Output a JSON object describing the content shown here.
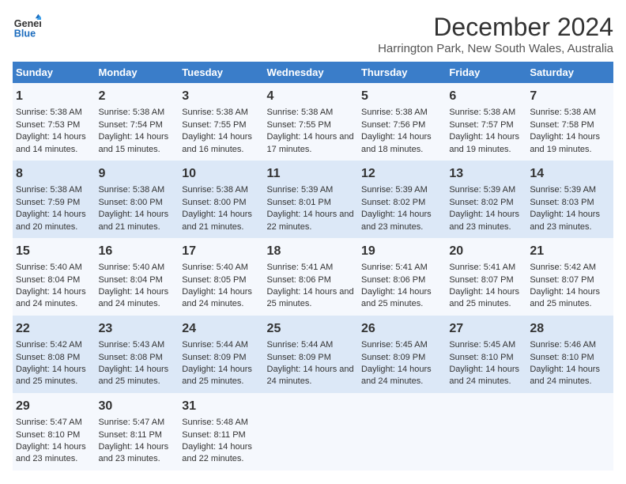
{
  "logo": {
    "line1": "General",
    "line2": "Blue"
  },
  "title": "December 2024",
  "subtitle": "Harrington Park, New South Wales, Australia",
  "days_of_week": [
    "Sunday",
    "Monday",
    "Tuesday",
    "Wednesday",
    "Thursday",
    "Friday",
    "Saturday"
  ],
  "weeks": [
    [
      {
        "day": "1",
        "sunrise": "Sunrise: 5:38 AM",
        "sunset": "Sunset: 7:53 PM",
        "daylight": "Daylight: 14 hours and 14 minutes."
      },
      {
        "day": "2",
        "sunrise": "Sunrise: 5:38 AM",
        "sunset": "Sunset: 7:54 PM",
        "daylight": "Daylight: 14 hours and 15 minutes."
      },
      {
        "day": "3",
        "sunrise": "Sunrise: 5:38 AM",
        "sunset": "Sunset: 7:55 PM",
        "daylight": "Daylight: 14 hours and 16 minutes."
      },
      {
        "day": "4",
        "sunrise": "Sunrise: 5:38 AM",
        "sunset": "Sunset: 7:55 PM",
        "daylight": "Daylight: 14 hours and 17 minutes."
      },
      {
        "day": "5",
        "sunrise": "Sunrise: 5:38 AM",
        "sunset": "Sunset: 7:56 PM",
        "daylight": "Daylight: 14 hours and 18 minutes."
      },
      {
        "day": "6",
        "sunrise": "Sunrise: 5:38 AM",
        "sunset": "Sunset: 7:57 PM",
        "daylight": "Daylight: 14 hours and 19 minutes."
      },
      {
        "day": "7",
        "sunrise": "Sunrise: 5:38 AM",
        "sunset": "Sunset: 7:58 PM",
        "daylight": "Daylight: 14 hours and 19 minutes."
      }
    ],
    [
      {
        "day": "8",
        "sunrise": "Sunrise: 5:38 AM",
        "sunset": "Sunset: 7:59 PM",
        "daylight": "Daylight: 14 hours and 20 minutes."
      },
      {
        "day": "9",
        "sunrise": "Sunrise: 5:38 AM",
        "sunset": "Sunset: 8:00 PM",
        "daylight": "Daylight: 14 hours and 21 minutes."
      },
      {
        "day": "10",
        "sunrise": "Sunrise: 5:38 AM",
        "sunset": "Sunset: 8:00 PM",
        "daylight": "Daylight: 14 hours and 21 minutes."
      },
      {
        "day": "11",
        "sunrise": "Sunrise: 5:39 AM",
        "sunset": "Sunset: 8:01 PM",
        "daylight": "Daylight: 14 hours and 22 minutes."
      },
      {
        "day": "12",
        "sunrise": "Sunrise: 5:39 AM",
        "sunset": "Sunset: 8:02 PM",
        "daylight": "Daylight: 14 hours and 23 minutes."
      },
      {
        "day": "13",
        "sunrise": "Sunrise: 5:39 AM",
        "sunset": "Sunset: 8:02 PM",
        "daylight": "Daylight: 14 hours and 23 minutes."
      },
      {
        "day": "14",
        "sunrise": "Sunrise: 5:39 AM",
        "sunset": "Sunset: 8:03 PM",
        "daylight": "Daylight: 14 hours and 23 minutes."
      }
    ],
    [
      {
        "day": "15",
        "sunrise": "Sunrise: 5:40 AM",
        "sunset": "Sunset: 8:04 PM",
        "daylight": "Daylight: 14 hours and 24 minutes."
      },
      {
        "day": "16",
        "sunrise": "Sunrise: 5:40 AM",
        "sunset": "Sunset: 8:04 PM",
        "daylight": "Daylight: 14 hours and 24 minutes."
      },
      {
        "day": "17",
        "sunrise": "Sunrise: 5:40 AM",
        "sunset": "Sunset: 8:05 PM",
        "daylight": "Daylight: 14 hours and 24 minutes."
      },
      {
        "day": "18",
        "sunrise": "Sunrise: 5:41 AM",
        "sunset": "Sunset: 8:06 PM",
        "daylight": "Daylight: 14 hours and 25 minutes."
      },
      {
        "day": "19",
        "sunrise": "Sunrise: 5:41 AM",
        "sunset": "Sunset: 8:06 PM",
        "daylight": "Daylight: 14 hours and 25 minutes."
      },
      {
        "day": "20",
        "sunrise": "Sunrise: 5:41 AM",
        "sunset": "Sunset: 8:07 PM",
        "daylight": "Daylight: 14 hours and 25 minutes."
      },
      {
        "day": "21",
        "sunrise": "Sunrise: 5:42 AM",
        "sunset": "Sunset: 8:07 PM",
        "daylight": "Daylight: 14 hours and 25 minutes."
      }
    ],
    [
      {
        "day": "22",
        "sunrise": "Sunrise: 5:42 AM",
        "sunset": "Sunset: 8:08 PM",
        "daylight": "Daylight: 14 hours and 25 minutes."
      },
      {
        "day": "23",
        "sunrise": "Sunrise: 5:43 AM",
        "sunset": "Sunset: 8:08 PM",
        "daylight": "Daylight: 14 hours and 25 minutes."
      },
      {
        "day": "24",
        "sunrise": "Sunrise: 5:44 AM",
        "sunset": "Sunset: 8:09 PM",
        "daylight": "Daylight: 14 hours and 25 minutes."
      },
      {
        "day": "25",
        "sunrise": "Sunrise: 5:44 AM",
        "sunset": "Sunset: 8:09 PM",
        "daylight": "Daylight: 14 hours and 24 minutes."
      },
      {
        "day": "26",
        "sunrise": "Sunrise: 5:45 AM",
        "sunset": "Sunset: 8:09 PM",
        "daylight": "Daylight: 14 hours and 24 minutes."
      },
      {
        "day": "27",
        "sunrise": "Sunrise: 5:45 AM",
        "sunset": "Sunset: 8:10 PM",
        "daylight": "Daylight: 14 hours and 24 minutes."
      },
      {
        "day": "28",
        "sunrise": "Sunrise: 5:46 AM",
        "sunset": "Sunset: 8:10 PM",
        "daylight": "Daylight: 14 hours and 24 minutes."
      }
    ],
    [
      {
        "day": "29",
        "sunrise": "Sunrise: 5:47 AM",
        "sunset": "Sunset: 8:10 PM",
        "daylight": "Daylight: 14 hours and 23 minutes."
      },
      {
        "day": "30",
        "sunrise": "Sunrise: 5:47 AM",
        "sunset": "Sunset: 8:11 PM",
        "daylight": "Daylight: 14 hours and 23 minutes."
      },
      {
        "day": "31",
        "sunrise": "Sunrise: 5:48 AM",
        "sunset": "Sunset: 8:11 PM",
        "daylight": "Daylight: 14 hours and 22 minutes."
      },
      {
        "day": "",
        "sunrise": "",
        "sunset": "",
        "daylight": ""
      },
      {
        "day": "",
        "sunrise": "",
        "sunset": "",
        "daylight": ""
      },
      {
        "day": "",
        "sunrise": "",
        "sunset": "",
        "daylight": ""
      },
      {
        "day": "",
        "sunrise": "",
        "sunset": "",
        "daylight": ""
      }
    ]
  ]
}
